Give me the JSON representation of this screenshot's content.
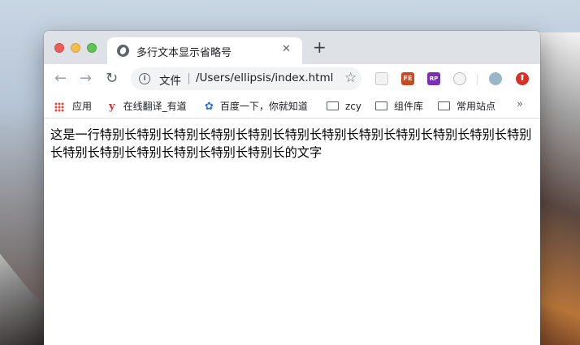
{
  "tab": {
    "title": "多行文本显示省略号",
    "close_glyph": "✕",
    "new_tab_glyph": "+"
  },
  "nav": {
    "back_glyph": "←",
    "forward_glyph": "→",
    "reload_glyph": "↻"
  },
  "omnibox": {
    "scheme_label": "文件",
    "url": "/Users/ellipsis/index.html",
    "star_glyph": "☆"
  },
  "extensions": [
    {
      "name": "ext-blank",
      "label": ""
    },
    {
      "name": "fe-helper",
      "label": "FE"
    },
    {
      "name": "rp-extension",
      "label": "RP"
    },
    {
      "name": "ext-circle",
      "label": ""
    },
    {
      "name": "profile-avatar",
      "label": ""
    },
    {
      "name": "ext-red",
      "label": "⬆"
    }
  ],
  "bookmarks": [
    {
      "label": "应用",
      "icon": "apps-grid-icon"
    },
    {
      "label": "在线翻译_有道",
      "icon": "youdao-icon"
    },
    {
      "label": "百度一下，你就知道",
      "icon": "baidu-paw-icon"
    },
    {
      "label": "zcy",
      "icon": "folder-icon"
    },
    {
      "label": "组件库",
      "icon": "folder-icon"
    },
    {
      "label": "常用站点",
      "icon": "folder-icon"
    }
  ],
  "bookmarks_more": "»",
  "content": {
    "text": "这是一行特别长特别长特别长特别长特别长特别长特别长特别长特别长特别长特别长特别长特别长特别长特别长特别长特别长特别长的文字"
  },
  "colors": {
    "titlebar": "#dee1e6",
    "omnibox": "#f1f3f4",
    "close": "#ec5f57",
    "minimize": "#f4be4f",
    "maximize": "#5fc454"
  }
}
